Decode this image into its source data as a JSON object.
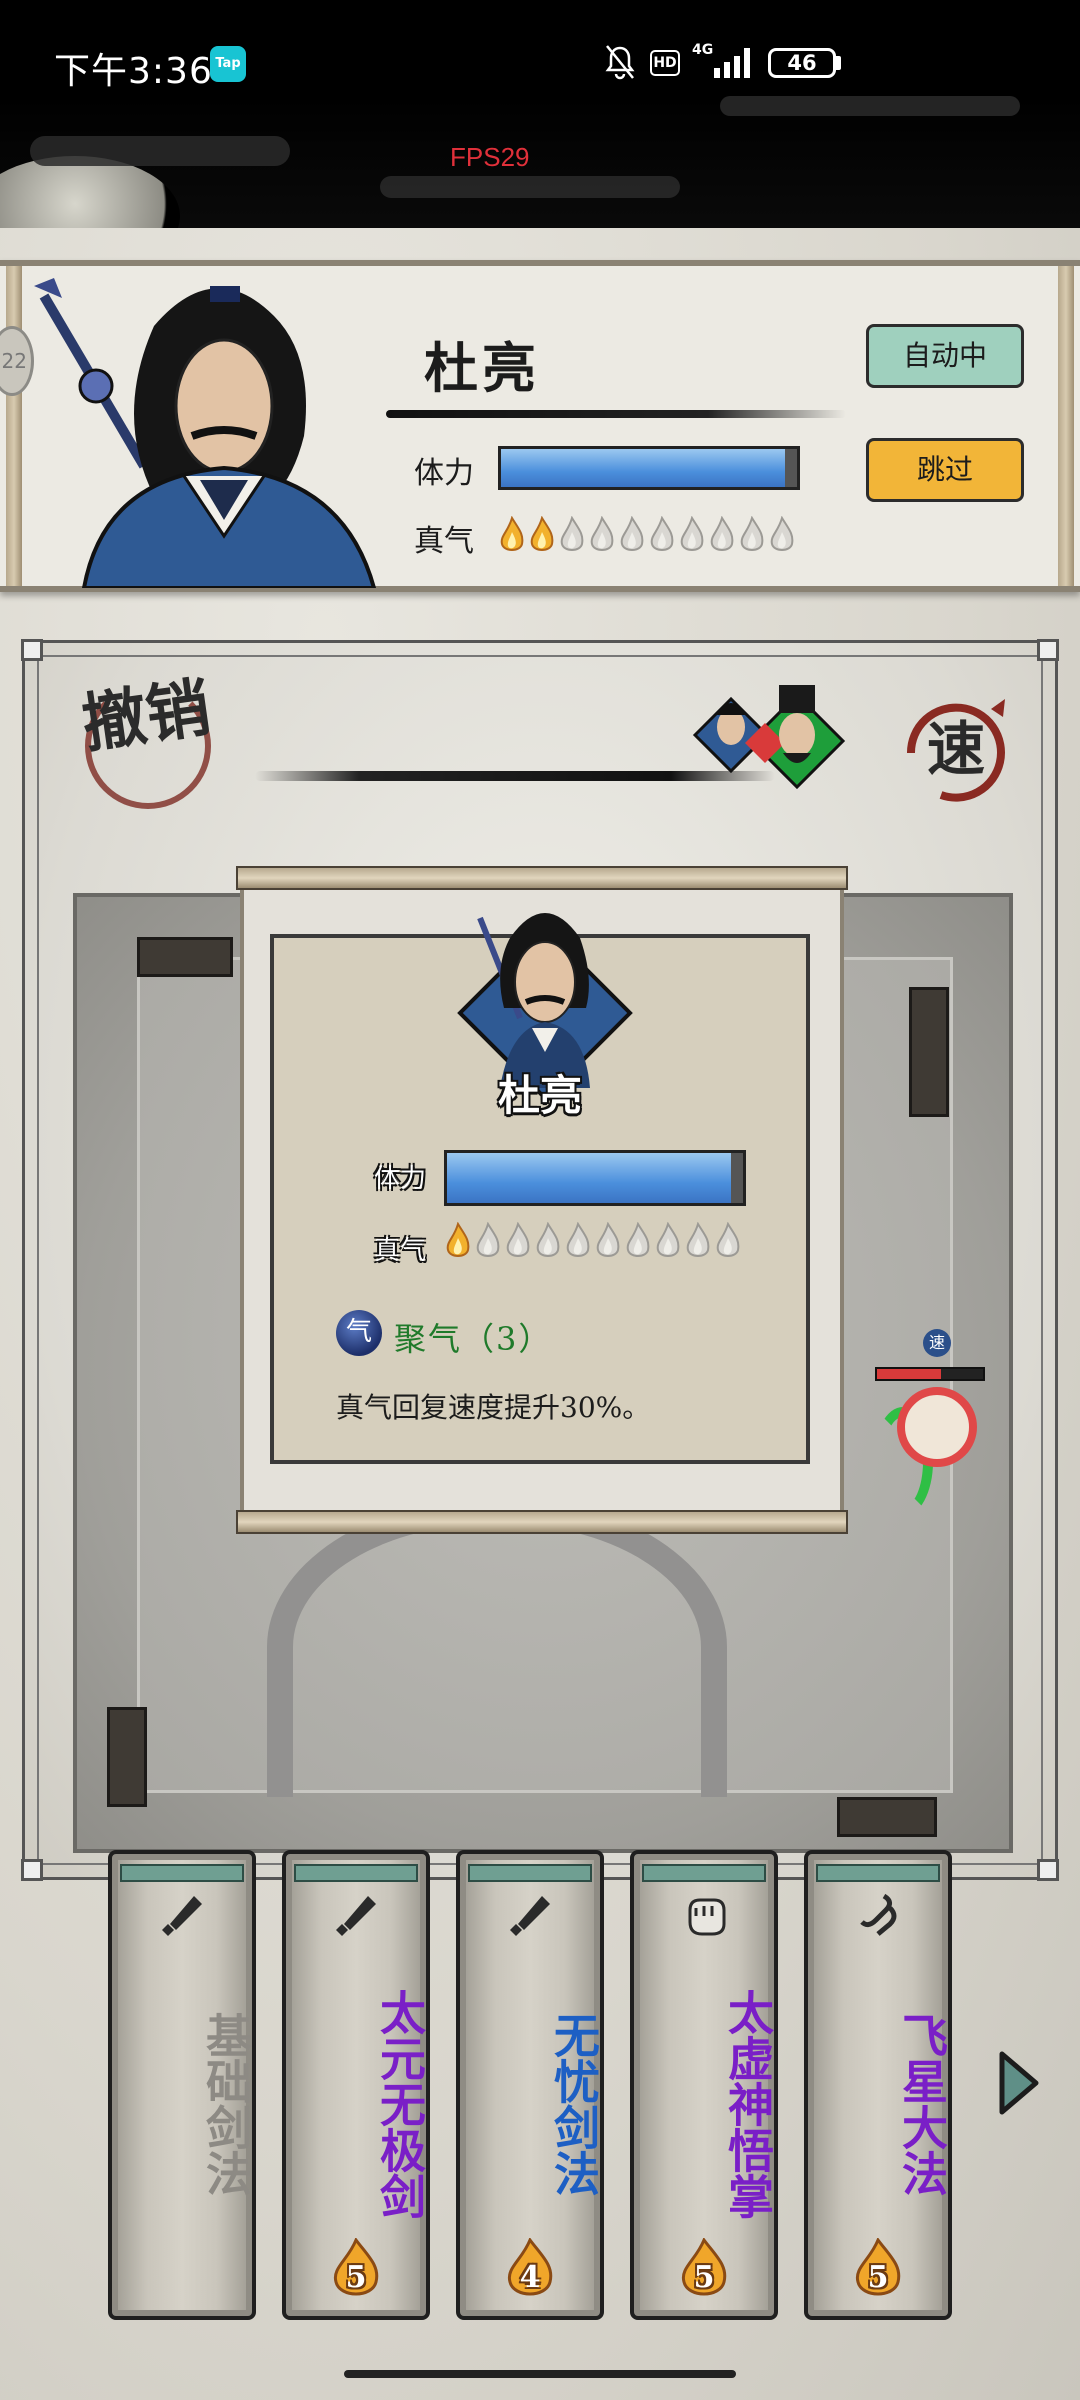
{
  "status_bar": {
    "time": "下午3:36",
    "tap_badge": "Tap",
    "hd": "HD",
    "network": "4G",
    "battery": "46"
  },
  "fps": "FPS29",
  "hero": {
    "name": "杜亮",
    "hp_label": "体力",
    "hp_fraction": 0.96,
    "qi_label": "真气",
    "qi_filled": 2,
    "qi_total": 10,
    "side_badge": "22"
  },
  "buttons": {
    "auto": "自动中",
    "skip": "跳过"
  },
  "arena": {
    "undo_label": "撤销",
    "speed_label": "速"
  },
  "enemy": {
    "speed_badge": "速",
    "hp_fraction": 0.6
  },
  "info_card": {
    "name": "杜亮",
    "hp_label": "体力",
    "hp_fraction": 0.96,
    "qi_label": "真气",
    "qi_filled": 1,
    "qi_total": 10,
    "buff_icon": "气",
    "buff_name": "聚气（3）",
    "buff_desc": "真气回复速度提升30%。"
  },
  "skills": [
    {
      "name": "基础剑法",
      "cost": "",
      "color": "#8d8a84",
      "icon": "sword-icon"
    },
    {
      "name": "太元无极剑",
      "cost": "5",
      "color": "#7a1fc7",
      "icon": "sword-icon"
    },
    {
      "name": "无忧剑法",
      "cost": "4",
      "color": "#1d5fc4",
      "icon": "sword-icon"
    },
    {
      "name": "太虚神悟掌",
      "cost": "5",
      "color": "#7a1fc7",
      "icon": "fist-icon"
    },
    {
      "name": "飞星大法",
      "cost": "5",
      "color": "#7a1fc7",
      "icon": "star-blade-icon"
    }
  ]
}
